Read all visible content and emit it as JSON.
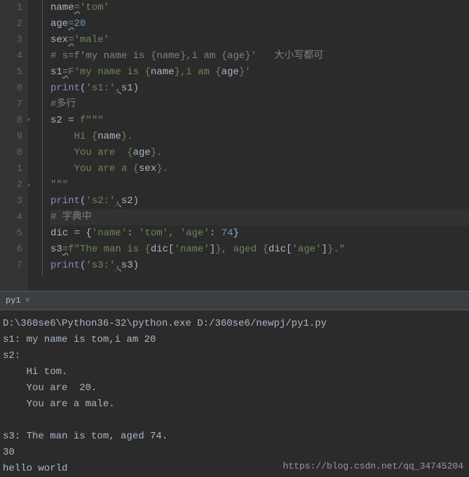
{
  "editor": {
    "lines": [
      {
        "n": "1",
        "html": "<span class='c-var'>name</span><span class='tilde'>=</span><span class='c-string'>'tom'</span>"
      },
      {
        "n": "2",
        "html": "<span class='c-var'>age</span><span class='tilde'>=</span><span class='c-num'>20</span>"
      },
      {
        "n": "3",
        "html": "<span class='c-var'>sex</span><span class='tilde'>=</span><span class='c-string'>'male'</span>"
      },
      {
        "n": "4",
        "html": "<span class='c-comment'># s=f'my name is {name},i am {age}'   大小写都可</span>"
      },
      {
        "n": "5",
        "html": "<span class='c-var'>s1</span><span class='tilde'>=</span><span class='c-fstr'>F'my name is {</span><span class='fvar'>name</span><span class='c-fstr'>},i am {</span><span class='fvar'>age</span><span class='c-fstr'>}'</span>"
      },
      {
        "n": "6",
        "html": "<span class='c-func'>print</span><span class='c-var'>(</span><span class='c-string'>'s1:'</span><span class='tilde'>,</span><span class='c-var'>s1)</span>"
      },
      {
        "n": "7",
        "html": "<span class='c-comment'>#多行</span>"
      },
      {
        "n": "8",
        "html": "<span class='c-var'>s2 = </span><span class='c-fstr'>f\"\"\"</span>",
        "fold": "▾"
      },
      {
        "n": "9",
        "html": "<span class='c-fstr'>    Hi {</span><span class='fvar'>name</span><span class='c-fstr'>}.</span>"
      },
      {
        "n": "0",
        "html": "<span class='c-fstr'>    You are  {</span><span class='fvar'>age</span><span class='c-fstr'>}.</span>"
      },
      {
        "n": "1",
        "html": "<span class='c-fstr'>    You are a {</span><span class='fvar'>sex</span><span class='c-fstr'>}.</span>"
      },
      {
        "n": "2",
        "html": "<span class='c-fstr'>\"\"\"</span>",
        "fold": "▴"
      },
      {
        "n": "3",
        "html": "<span class='c-func'>print</span><span class='c-var'>(</span><span class='c-string'>'s2:'</span><span class='tilde'>,</span><span class='c-var'>s2)</span>"
      },
      {
        "n": "4",
        "html": "<span class='c-comment'># 字典中</span>",
        "hl": true
      },
      {
        "n": "5",
        "html": "<span class='c-var'>dic = {</span><span class='c-string'>'name'</span><span class='c-var'>: </span><span class='c-string'>'tom'</span><span class='c-comma'>, </span><span class='c-string'>'age'</span><span class='c-var'>: </span><span class='c-num'>74</span><span class='c-var'>}</span>"
      },
      {
        "n": "6",
        "html": "<span class='c-var'>s3</span><span class='tilde'>=</span><span class='c-fstr'>f\"The man is {</span><span class='fvar'>dic[</span><span class='c-string'>'name'</span><span class='fvar'>]</span><span class='c-fstr'>}, aged {</span><span class='fvar'>dic[</span><span class='c-string'>'age'</span><span class='fvar'>]</span><span class='c-fstr'>}.\"</span>"
      },
      {
        "n": "7",
        "html": "<span class='c-func'>print</span><span class='c-var'>(</span><span class='c-string'>'s3:'</span><span class='tilde'>,</span><span class='c-var'>s3)</span>"
      }
    ]
  },
  "tab": {
    "label": "py1",
    "close": "×"
  },
  "console": {
    "lines": [
      "D:\\360se6\\Python36-32\\python.exe D:/360se6/newpj/py1.py",
      "s1: my name is tom,i am 20",
      "s2:",
      "    Hi tom.",
      "    You are  20.",
      "    You are a male.",
      "",
      "s3: The man is tom, aged 74.",
      "30",
      "hello world"
    ]
  },
  "watermark": "https://blog.csdn.net/qq_34745204"
}
